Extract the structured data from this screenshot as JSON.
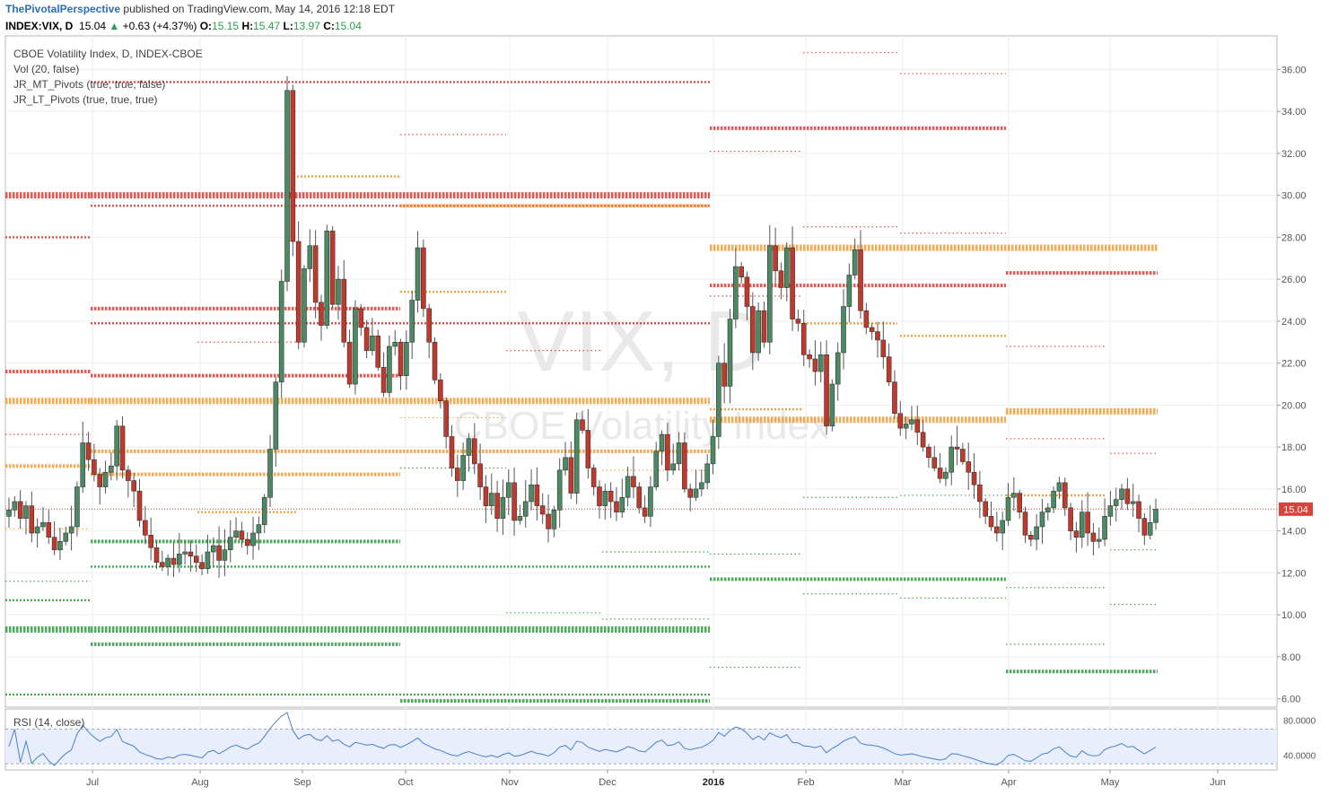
{
  "header": {
    "author": "ThePivotalPerspective",
    "published_text": "published on TradingView.com, May 14, 2016 12:18 EDT",
    "symbol": "INDEX:VIX, D",
    "last": "15.04",
    "up_arrow": "▲",
    "change": "+0.63 (+4.37%)",
    "o_label": "O:",
    "o_value": "15.15",
    "h_label": "H:",
    "h_value": "15.47",
    "l_label": "L:",
    "l_value": "13.97",
    "c_label": "C:",
    "c_value": "15.04"
  },
  "legend": [
    "CBOE Volatility Index, D, INDEX-CBOE",
    "Vol (20, false)",
    "JR_MT_Pivots (true, true, false)",
    "JR_LT_Pivots (true, true, true)"
  ],
  "watermark": {
    "symbol": "VIX, D",
    "name": "CBOE Volatility Index"
  },
  "rsi_label": "RSI (14, close)",
  "price_label": "15.04",
  "colors": {
    "up": "#4b8a63",
    "down": "#c0392b",
    "resistance": "#e53935",
    "pivot": "#f59a35",
    "support": "#2e9e3f",
    "rsi_line": "#4a7fcf",
    "rsi_band": "#e8eefb"
  },
  "chart_data": {
    "type": "candlestick",
    "title": "CBOE Volatility Index, D, INDEX-CBOE",
    "x_ticks": [
      "Jul",
      "Aug",
      "Sep",
      "Oct",
      "Nov",
      "Dec",
      "2016",
      "Feb",
      "Mar",
      "Apr",
      "May",
      "Jun"
    ],
    "y_ticks": [
      "36.00",
      "34.00",
      "32.00",
      "30.00",
      "28.00",
      "26.00",
      "24.00",
      "22.00",
      "20.00",
      "18.00",
      "16.00",
      "14.00",
      "12.00",
      "10.00",
      "8.00",
      "6.00"
    ],
    "y_range": [
      5.6,
      37.6
    ],
    "last_close": 15.04,
    "series": [
      {
        "name": "INDEX:VIX",
        "close": [
          15.0,
          15.4,
          14.6,
          15.2,
          13.9,
          14.2,
          14.4,
          13.7,
          13.1,
          13.5,
          13.9,
          14.2,
          16.1,
          18.2,
          17.4,
          16.7,
          16.1,
          16.8,
          17.1,
          19.0,
          16.9,
          16.4,
          15.9,
          14.5,
          13.8,
          13.2,
          12.5,
          12.3,
          12.7,
          12.4,
          12.9,
          13.0,
          12.8,
          12.5,
          12.2,
          13.0,
          13.3,
          12.6,
          13.1,
          13.7,
          14.0,
          13.6,
          13.3,
          13.9,
          14.3,
          15.6,
          17.9,
          21.1,
          25.9,
          35.0,
          27.8,
          23.0,
          26.5,
          27.6,
          24.9,
          23.8,
          28.3,
          24.8,
          26.0,
          23.0,
          21.0,
          24.6,
          23.7,
          22.6,
          23.3,
          21.8,
          20.6,
          22.8,
          23.0,
          21.4,
          23.0,
          25.0,
          27.5,
          24.6,
          23.0,
          21.2,
          20.2,
          18.5,
          17.0,
          16.4,
          17.6,
          18.4,
          17.2,
          16.1,
          15.2,
          15.8,
          14.6,
          15.6,
          16.3,
          14.5,
          14.7,
          15.4,
          16.2,
          15.2,
          14.8,
          14.1,
          15.0,
          16.9,
          17.5,
          15.8,
          19.3,
          18.8,
          17.0,
          16.1,
          15.2,
          15.9,
          15.4,
          14.9,
          15.6,
          16.6,
          16.1,
          15.1,
          14.7,
          16.1,
          17.8,
          18.6,
          16.9,
          17.2,
          18.2,
          16.0,
          15.6,
          16.0,
          16.3,
          17.2,
          18.5,
          22.0,
          20.9,
          24.1,
          26.6,
          26.1,
          24.7,
          22.5,
          24.5,
          23.0,
          27.6,
          26.4,
          25.6,
          27.5,
          24.1,
          23.9,
          22.4,
          22.2,
          21.6,
          22.4,
          19.0,
          21.0,
          22.5,
          24.7,
          26.2,
          27.4,
          24.5,
          23.7,
          23.5,
          23.1,
          22.3,
          21.1,
          19.6,
          18.9,
          19.1,
          19.3,
          18.7,
          18.0,
          17.5,
          17.0,
          16.5,
          16.8,
          18.0,
          17.9,
          17.3,
          16.8,
          16.2,
          15.4,
          14.7,
          14.2,
          13.9,
          14.5,
          15.6,
          15.8,
          14.9,
          13.8,
          13.6,
          14.2,
          14.9,
          15.1,
          15.9,
          16.3,
          15.1,
          14.0,
          13.7,
          14.9,
          13.9,
          13.5,
          13.6,
          14.7,
          15.2,
          15.5,
          16.0,
          15.3,
          15.4,
          14.6,
          13.8,
          14.4,
          15.04
        ]
      }
    ]
  }
}
